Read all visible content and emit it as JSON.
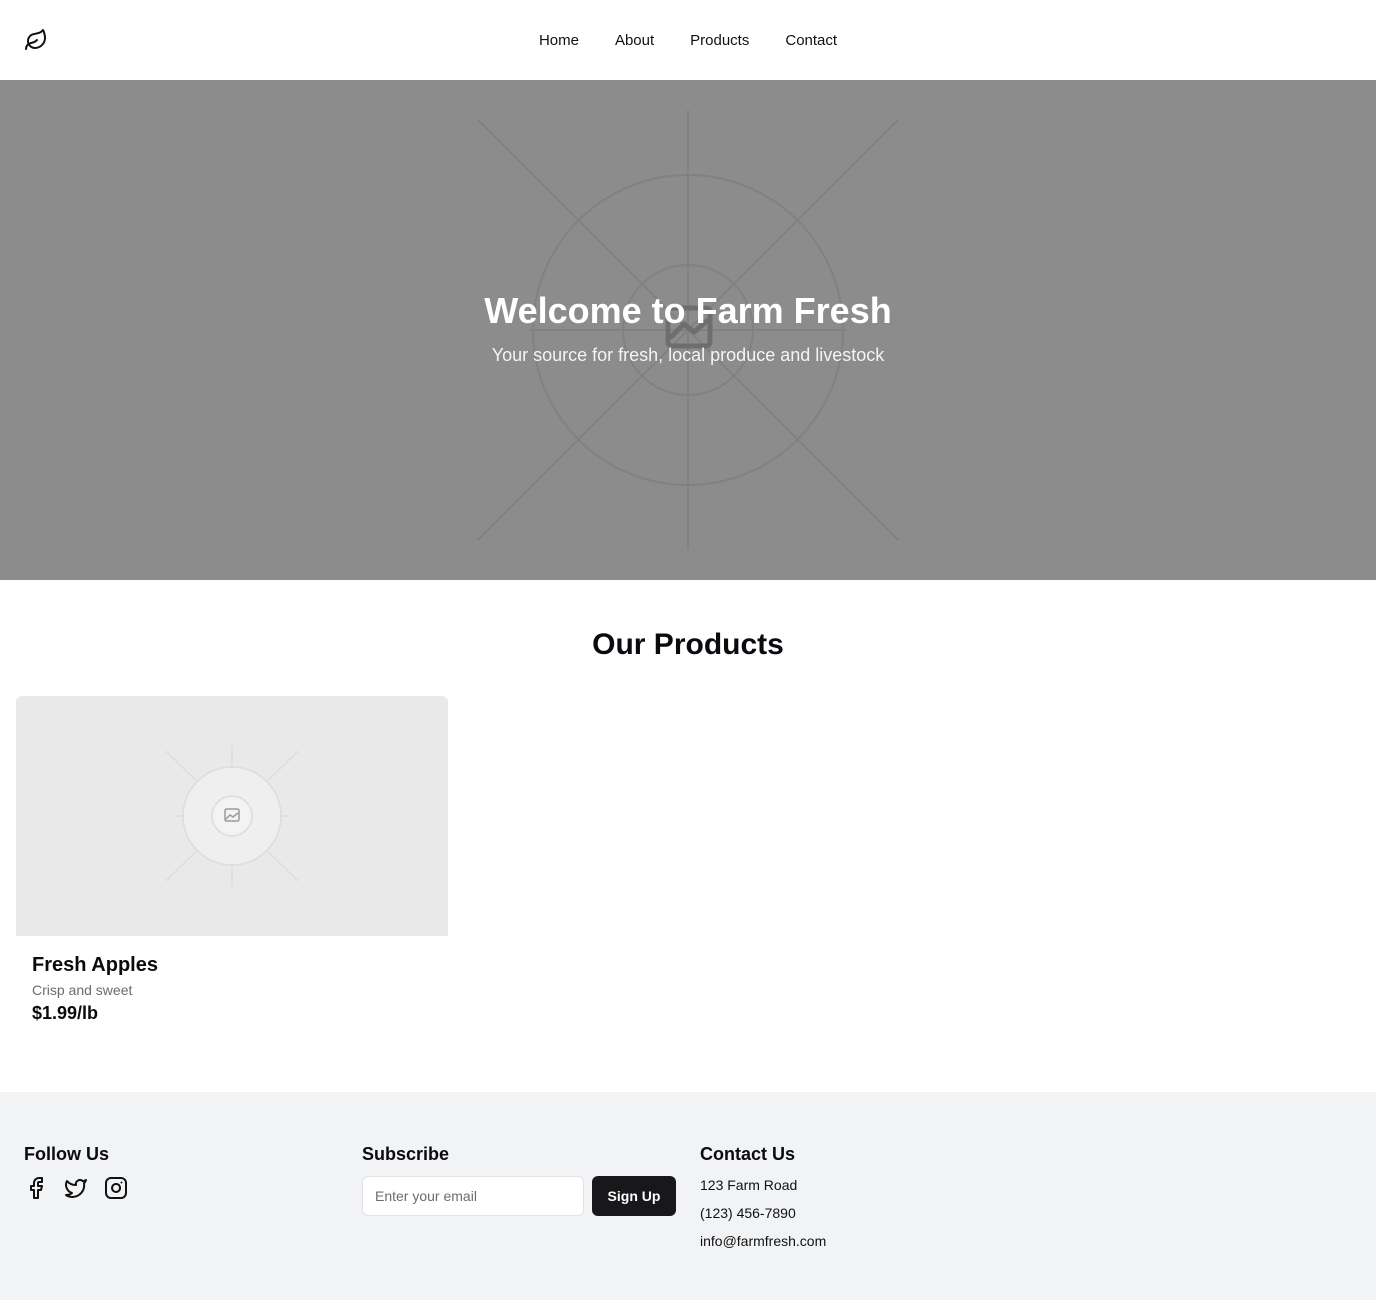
{
  "header": {
    "logo_icon": "leaf-icon",
    "nav": [
      {
        "label": "Home"
      },
      {
        "label": "About"
      },
      {
        "label": "Products"
      },
      {
        "label": "Contact"
      }
    ]
  },
  "hero": {
    "title": "Welcome to Farm Fresh",
    "subtitle": "Your source for fresh, local produce and livestock",
    "image_icon": "image-placeholder-icon"
  },
  "products": {
    "title": "Our Products",
    "items": [
      {
        "name": "Fresh Apples",
        "description": "Crisp and sweet",
        "price": "$1.99/lb",
        "image_icon": "image-placeholder-icon"
      }
    ]
  },
  "footer": {
    "follow": {
      "title": "Follow Us",
      "icons": [
        "facebook-icon",
        "twitter-icon",
        "instagram-icon"
      ]
    },
    "subscribe": {
      "title": "Subscribe",
      "email_placeholder": "Enter your email",
      "email_value": "",
      "button_label": "Sign Up"
    },
    "contact": {
      "title": "Contact Us",
      "address": "123 Farm Road",
      "phone": "(123) 456-7890",
      "email": "info@farmfresh.com"
    }
  },
  "colors": {
    "hero_bg": "#8c8c8c",
    "footer_bg": "#f2f3f5",
    "button_bg": "#18181b",
    "card_image_bg": "#e9e9e9"
  }
}
